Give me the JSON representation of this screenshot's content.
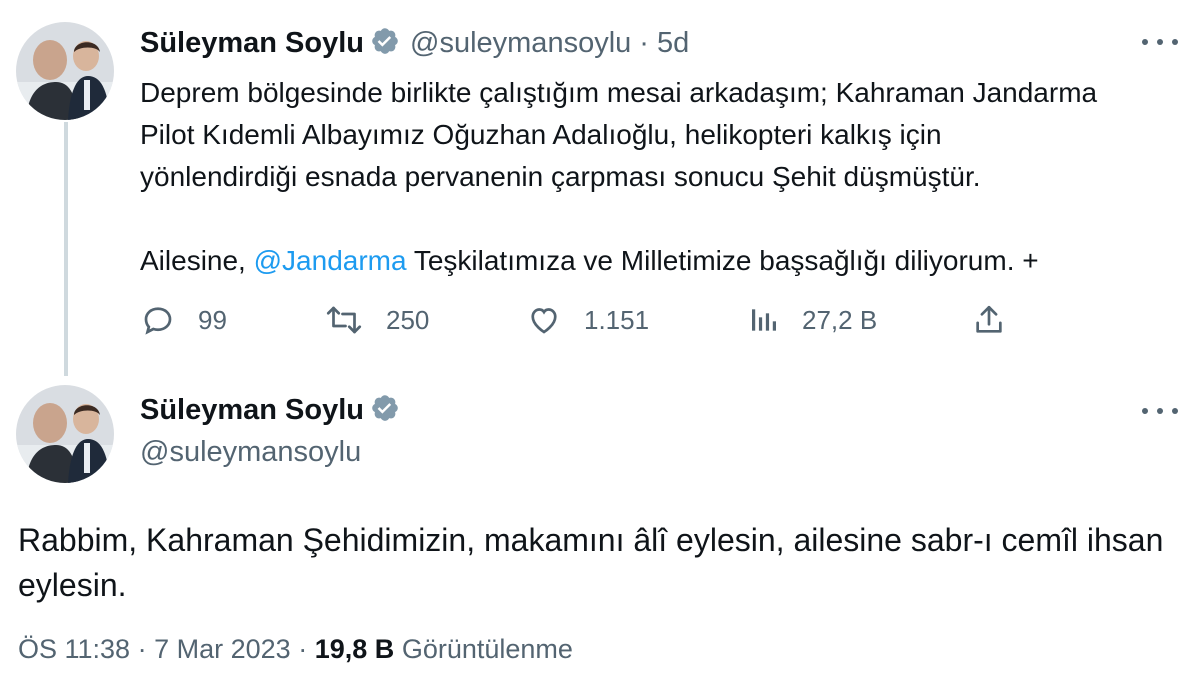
{
  "tweet1": {
    "author_name": "Süleyman Soylu",
    "handle": "@suleymansoylu",
    "separator": "·",
    "time_ago": "5d",
    "text_lines": [
      "Deprem bölgesinde birlikte çalıştığım mesai arkadaşım; Kahraman Jandarma",
      "Pilot Kıdemli Albayımız Oğuzhan Adalıoğlu, helikopteri kalkış için",
      "yönlendirdiği esnada pervanenin çarpması sonucu Şehit düşmüştür."
    ],
    "text_line2_before": "Ailesine, ",
    "text_line2_mention": "@Jandarma",
    "text_line2_after": " Teşkilatımıza ve Milletimize başsağlığı diliyorum. +",
    "actions": {
      "replies": "99",
      "retweets": "250",
      "likes": "1.151",
      "views": "27,2 B"
    }
  },
  "tweet2": {
    "author_name": "Süleyman Soylu",
    "handle": "@suleymansoylu",
    "text": "Rabbim, Kahraman Şehidimizin, makamını âlî eylesin, ailesine sabr-ı cemîl ihsan eylesin.",
    "meta_time": "ÖS 11:38",
    "meta_sep1": "·",
    "meta_date": "7 Mar 2023",
    "meta_sep2": "·",
    "meta_views_count": "19,8 B",
    "meta_views_label": "Görüntülenme"
  },
  "icons": {
    "reply": "reply-icon",
    "retweet": "retweet-icon",
    "like": "heart-icon",
    "views": "analytics-icon",
    "share": "share-icon",
    "more": "more-icon",
    "verified": "verified-badge-icon"
  },
  "colors": {
    "text": "#0f1419",
    "secondary": "#536471",
    "link": "#1d9bf0",
    "verified": "#829aab",
    "thread_line": "#cfd9de"
  }
}
